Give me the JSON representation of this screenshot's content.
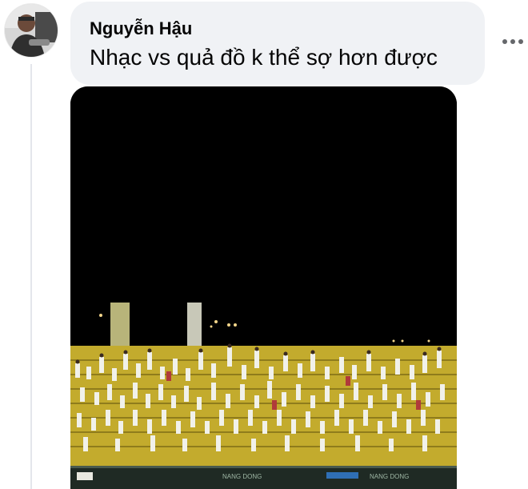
{
  "comment": {
    "author": "Nguyễn Hậu",
    "text": "Nhạc vs quả đồ k thể sợ hơn được"
  },
  "media": {
    "board_text_left": "NANG DONG",
    "board_text_right": "NANG DONG"
  },
  "icons": {
    "more": "more-horizontal-icon"
  },
  "colors": {
    "bubble": "#f0f2f5",
    "text": "#050505",
    "seats": "#c9b23a"
  }
}
